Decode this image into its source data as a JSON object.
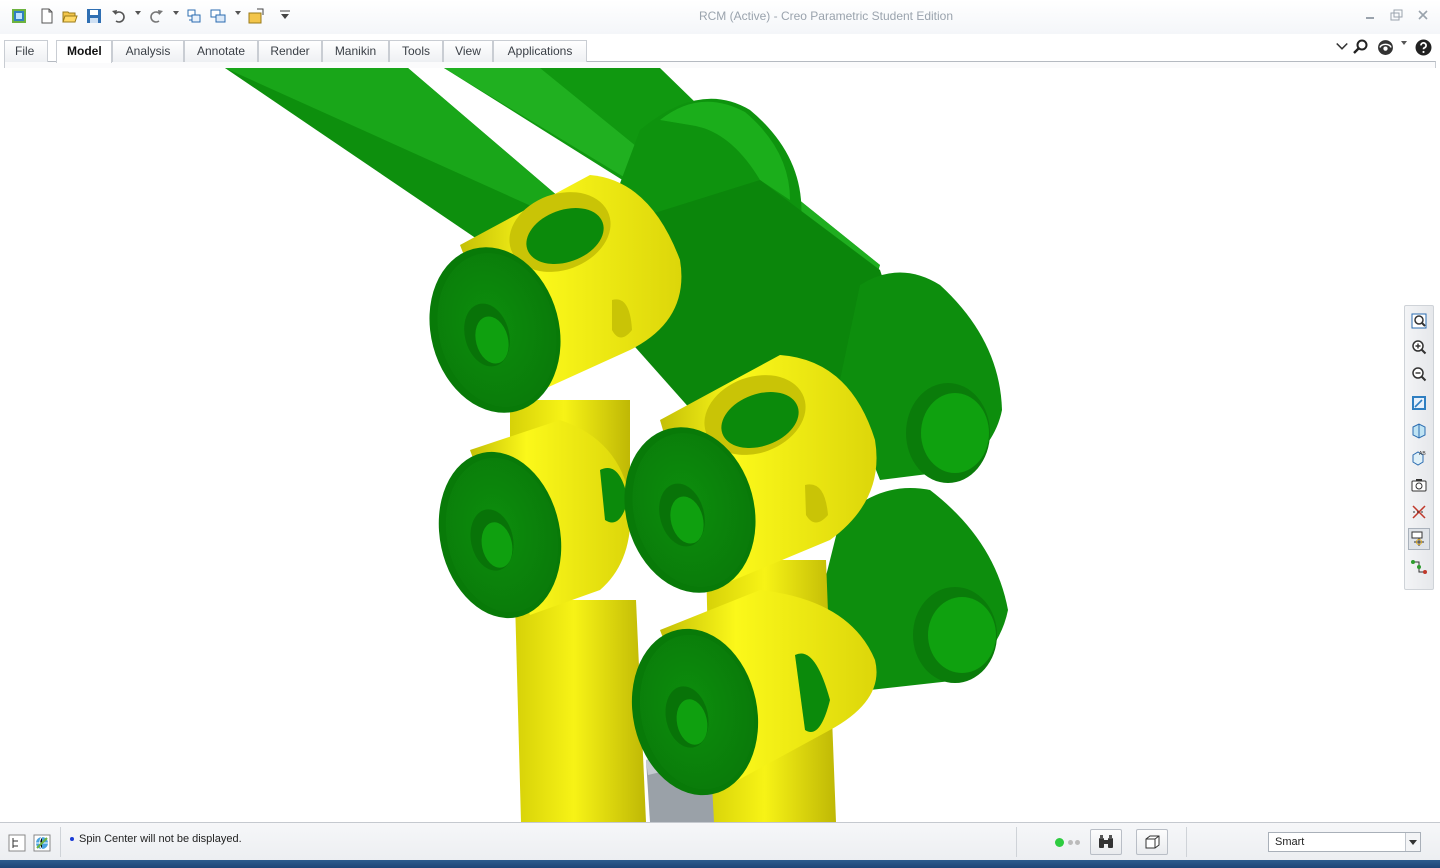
{
  "window": {
    "title": "RCM (Active) - Creo Parametric Student Edition"
  },
  "quick_access": {
    "icons": [
      "app-icon",
      "new-icon",
      "open-icon",
      "save-icon",
      "undo-icon",
      "redo-icon",
      "regenerate-icon",
      "windows-icon",
      "close-window-icon",
      "customize-icon"
    ]
  },
  "ribbon": {
    "tabs": [
      {
        "label": "File"
      },
      {
        "label": "Model"
      },
      {
        "label": "Analysis"
      },
      {
        "label": "Annotate"
      },
      {
        "label": "Render"
      },
      {
        "label": "Manikin"
      },
      {
        "label": "Tools"
      },
      {
        "label": "View"
      },
      {
        "label": "Applications"
      }
    ],
    "active_tab": "Model",
    "right_icons": [
      "minimize-ribbon-icon",
      "search-icon",
      "community-icon",
      "help-icon"
    ]
  },
  "view_toolbar": {
    "icons": [
      "refit-icon",
      "zoom-in-icon",
      "zoom-out-icon",
      "repaint-icon",
      "display-style-icon",
      "saved-orientations-icon",
      "view-manager-icon",
      "datum-display-icon",
      "spin-center-icon",
      "annotation-display-icon"
    ],
    "active": "spin-center-icon"
  },
  "status_bar": {
    "message": "Spin Center will not be displayed.",
    "filter": "Smart"
  },
  "colors": {
    "part_green": "#0f9a0f",
    "part_yellow": "#f2ee0a",
    "background": "#ffffff"
  }
}
